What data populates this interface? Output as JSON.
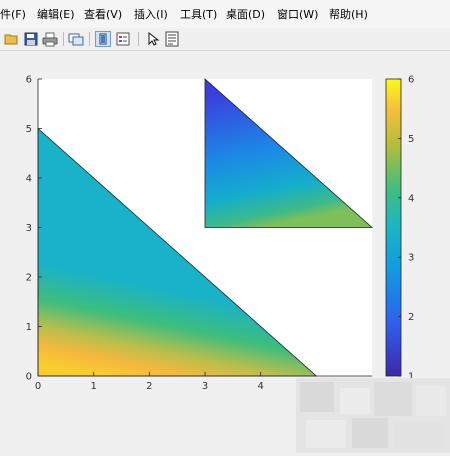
{
  "menu": {
    "items": [
      "件(F)",
      "编辑(E)",
      "查看(V)",
      "插入(I)",
      "工具(T)",
      "桌面(D)",
      "窗口(W)",
      "帮助(H)"
    ]
  },
  "toolbar": {
    "buttons": [
      "open-icon",
      "save-icon",
      "print-icon",
      "link-figure-icon",
      "insert-colorbar-icon",
      "insert-legend-icon",
      "select-arrow-icon",
      "property-inspector-icon"
    ]
  },
  "chart_data": {
    "type": "heatmap",
    "title": "",
    "xlabel": "",
    "ylabel": "",
    "xlim": [
      0,
      6
    ],
    "ylim": [
      0,
      6
    ],
    "xticks": [
      "0",
      "1",
      "2",
      "3",
      "4"
    ],
    "yticks": [
      "0",
      "1",
      "2",
      "3",
      "4",
      "5",
      "6"
    ],
    "patches": [
      {
        "vertices": [
          [
            0,
            0
          ],
          [
            5,
            0
          ],
          [
            0,
            5
          ]
        ],
        "color_values": [
          6,
          6,
          3
        ]
      },
      {
        "vertices": [
          [
            3,
            3
          ],
          [
            6,
            3
          ],
          [
            3,
            6
          ]
        ],
        "color_values": [
          3.5,
          3,
          1
        ]
      }
    ],
    "colormap": "parula",
    "colorbar": {
      "limits": [
        1,
        6
      ],
      "ticks": [
        "1",
        "2",
        "3",
        "4",
        "5",
        "6"
      ]
    }
  }
}
